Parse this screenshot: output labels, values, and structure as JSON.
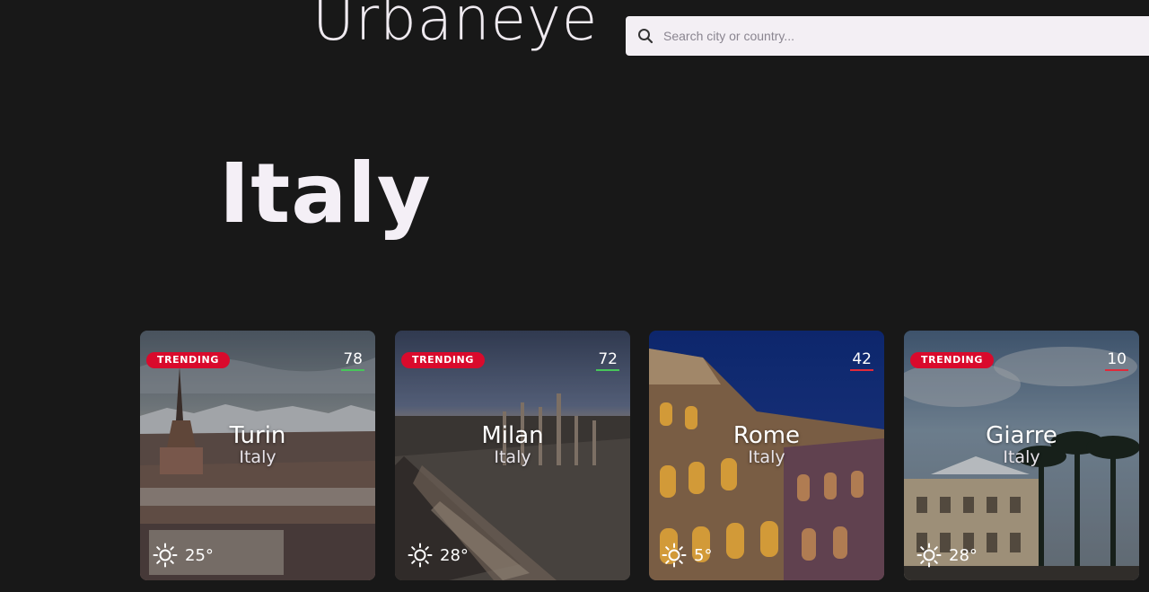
{
  "app": {
    "logo": "Urbaneye"
  },
  "search": {
    "placeholder": "Search city or country..."
  },
  "page": {
    "title": "Italy"
  },
  "cards": [
    {
      "badge": "TRENDING",
      "score": "78",
      "score_status": "good",
      "city": "Turin",
      "country": "Italy",
      "temp": "25°",
      "icon": "sun-icon"
    },
    {
      "badge": "TRENDING",
      "score": "72",
      "score_status": "good",
      "city": "Milan",
      "country": "Italy",
      "temp": "28°",
      "icon": "sun-icon"
    },
    {
      "badge": "",
      "score": "42",
      "score_status": "bad",
      "city": "Rome",
      "country": "Italy",
      "temp": "5°",
      "icon": "sun-icon"
    },
    {
      "badge": "TRENDING",
      "score": "10",
      "score_status": "bad",
      "city": "Giarre",
      "country": "Italy",
      "temp": "28°",
      "icon": "sun-icon"
    }
  ],
  "colors": {
    "background": "#181818",
    "badge": "#d90a2c",
    "score_good": "#47c55a",
    "score_bad": "#e02a3a"
  }
}
